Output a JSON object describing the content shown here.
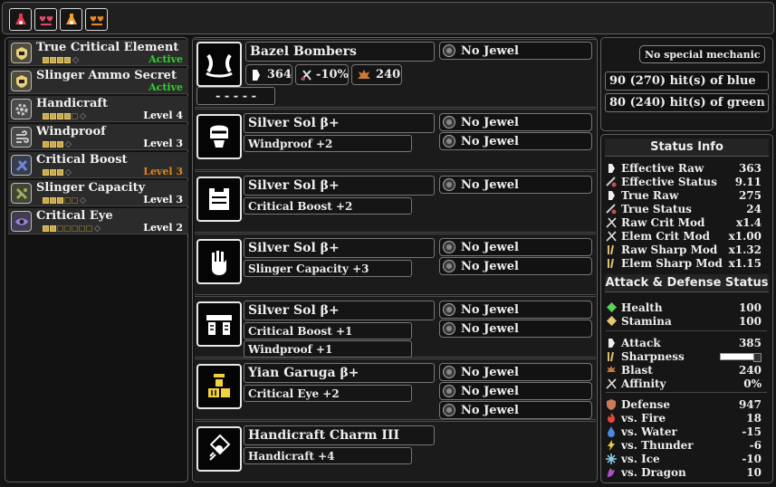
{
  "topbar": {
    "items": [
      {
        "icon": "red-flask-icon",
        "color": "#e8394a"
      },
      {
        "icon": "hearts-icon",
        "color": "#e04a6a"
      },
      {
        "icon": "orange-flask-icon",
        "color": "#f0a030"
      },
      {
        "icon": "orange-hearts-icon",
        "color": "#e88a20"
      }
    ]
  },
  "skills": [
    {
      "name": "True Critical Element",
      "status": "Active",
      "pips": 4,
      "max": 4,
      "status_color": "#2fd12f",
      "icon": "shield-skill-icon",
      "icon_color": "#e8d080"
    },
    {
      "name": "Slinger Ammo Secret",
      "status": "Active",
      "pips": 0,
      "max": 0,
      "status_color": "#2fd12f",
      "icon": "shield-skill-icon",
      "icon_color": "#e8d080"
    },
    {
      "name": "Handicraft",
      "status": "Level 4",
      "pips": 4,
      "max": 5,
      "status_color": "#ffffff",
      "icon": "gear-skill-icon",
      "icon_color": "#c8c8c8"
    },
    {
      "name": "Windproof",
      "status": "Level 3",
      "pips": 3,
      "max": 3,
      "status_color": "#ffffff",
      "icon": "wind-skill-icon",
      "icon_color": "#c8c8c8"
    },
    {
      "name": "Critical Boost",
      "status": "Level 3",
      "pips": 3,
      "max": 3,
      "status_color": "#e0861a",
      "icon": "crit-skill-icon",
      "icon_color": "#6e88d8"
    },
    {
      "name": "Slinger Capacity",
      "status": "Level 3",
      "pips": 3,
      "max": 5,
      "status_color": "#ffffff",
      "icon": "slinger-skill-icon",
      "icon_color": "#9cb060"
    },
    {
      "name": "Critical Eye",
      "status": "Level 2",
      "pips": 2,
      "max": 7,
      "status_color": "#ffffff",
      "icon": "eye-skill-icon",
      "icon_color": "#9a80e0"
    }
  ],
  "weapon": {
    "name": "Bazel Bombers",
    "slot_text": "- - - - -",
    "jewel": "No Jewel",
    "attack": "364",
    "affinity": "-10%",
    "element": "240"
  },
  "armor": [
    {
      "name": "Silver Sol β+",
      "skills": [
        "Windproof +2"
      ],
      "jewels": [
        "No Jewel",
        "No Jewel"
      ],
      "icon": "helm-icon",
      "icon_color": "#ffffff"
    },
    {
      "name": "Silver Sol β+",
      "skills": [
        "Critical Boost +2"
      ],
      "jewels": [
        "No Jewel"
      ],
      "icon": "chest-icon",
      "icon_color": "#ffffff"
    },
    {
      "name": "Silver Sol β+",
      "skills": [
        "Slinger Capacity +3"
      ],
      "jewels": [
        "No Jewel",
        "No Jewel"
      ],
      "icon": "arms-icon",
      "icon_color": "#ffffff"
    },
    {
      "name": "Silver Sol β+",
      "skills": [
        "Critical Boost +1",
        "Windproof +1"
      ],
      "jewels": [
        "No Jewel",
        "No Jewel"
      ],
      "icon": "waist-icon",
      "icon_color": "#ffffff"
    },
    {
      "name": "Yian Garuga β+",
      "skills": [
        "Critical Eye +2"
      ],
      "jewels": [
        "No Jewel",
        "No Jewel",
        "No Jewel"
      ],
      "icon": "legs-icon",
      "icon_color": "#f2d23a"
    },
    {
      "name": "Handicraft Charm III",
      "skills": [
        "Handicraft +4"
      ],
      "jewels": [],
      "icon": "charm-icon",
      "icon_color": "#ffffff"
    }
  ],
  "mechanic": {
    "title": "No special mechanic",
    "blue": "90 (270) hit(s) of blue",
    "green": "80 (240) hit(s) of green"
  },
  "status_info": {
    "title": "Status Info",
    "rows": [
      {
        "label": "Effective Raw",
        "value": "363",
        "icon": "sword-icon"
      },
      {
        "label": "Effective Status",
        "value": "9.11",
        "icon": "status-icon"
      },
      {
        "label": "True Raw",
        "value": "275",
        "icon": "sword-icon"
      },
      {
        "label": "True Status",
        "value": "24",
        "icon": "status-icon"
      },
      {
        "label": "Raw Crit Mod",
        "value": "x1.4",
        "icon": "crit-icon"
      },
      {
        "label": "Elem Crit Mod",
        "value": "x1.00",
        "icon": "crit-icon"
      },
      {
        "label": "Raw Sharp Mod",
        "value": "x1.32",
        "icon": "sharp-icon"
      },
      {
        "label": "Elem Sharp Mod",
        "value": "x1.15",
        "icon": "sharp-icon"
      }
    ]
  },
  "attack_defense": {
    "title": "Attack & Defense Status",
    "vitals": [
      {
        "label": "Health",
        "value": "100",
        "icon": "health-icon",
        "color": "#5bd35b"
      },
      {
        "label": "Stamina",
        "value": "100",
        "icon": "stamina-icon",
        "color": "#e8c870"
      }
    ],
    "attack": [
      {
        "label": "Attack",
        "value": "385",
        "icon": "sword-icon"
      },
      {
        "label": "Sharpness",
        "value": "",
        "icon": "sharp-icon"
      },
      {
        "label": "Blast",
        "value": "240",
        "icon": "blast-icon"
      },
      {
        "label": "Affinity",
        "value": "0%",
        "icon": "crit-icon"
      }
    ],
    "defense": [
      {
        "label": "Defense",
        "value": "947",
        "icon": "defense-icon",
        "color": "#c87a5a"
      },
      {
        "label": "vs. Fire",
        "value": "18",
        "icon": "fire-icon",
        "color": "#e04a3a"
      },
      {
        "label": "vs. Water",
        "value": "-15",
        "icon": "water-icon",
        "color": "#4a8ae0"
      },
      {
        "label": "vs. Thunder",
        "value": "-6",
        "icon": "thunder-icon",
        "color": "#e8d040"
      },
      {
        "label": "vs. Ice",
        "value": "-10",
        "icon": "ice-icon",
        "color": "#8ad0f0"
      },
      {
        "label": "vs. Dragon",
        "value": "10",
        "icon": "dragon-icon",
        "color": "#b050c8"
      }
    ]
  }
}
